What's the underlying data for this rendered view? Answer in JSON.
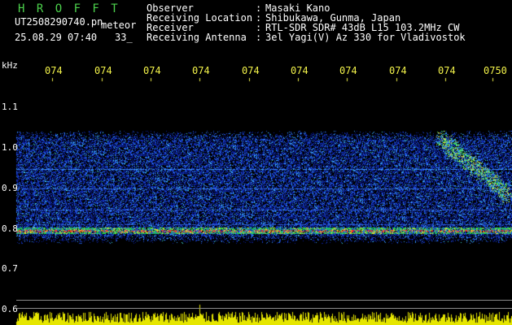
{
  "header": {
    "app_title": "H R O F F T",
    "filename_prefix": "UT2508290740.pn",
    "meteor_label": "meteor",
    "datetime": "25.08.29 07:40",
    "count": "33_"
  },
  "info": {
    "labels": [
      "Observer",
      "Receiving Location",
      "Receiver",
      "Receiving Antenna"
    ],
    "colons": [
      ":",
      ":",
      ":",
      ":"
    ],
    "values": [
      "Masaki Kano",
      "Shibukawa, Gunma, Japan",
      "RTL-SDR SDR# 43dB L15 103.2MHz CW",
      "3el Yagi(V) Az 330 for Vladivostok"
    ]
  },
  "axis": {
    "unit": "kHz",
    "y_ticks": [
      "1.1",
      "1.0",
      "0.9",
      "0.8",
      "0.7",
      "0.6"
    ],
    "x_ticks": [
      "074",
      "074",
      "074",
      "074",
      "074",
      "074",
      "074",
      "074",
      "074",
      "0750"
    ]
  },
  "colors": {
    "bg": "#000000",
    "spectrogram_noise": "#1533c8",
    "echo_band": "#ff3020",
    "tick_text": "#f2f24a",
    "title_green": "#4cd14c",
    "histogram": "#e6e600"
  }
}
